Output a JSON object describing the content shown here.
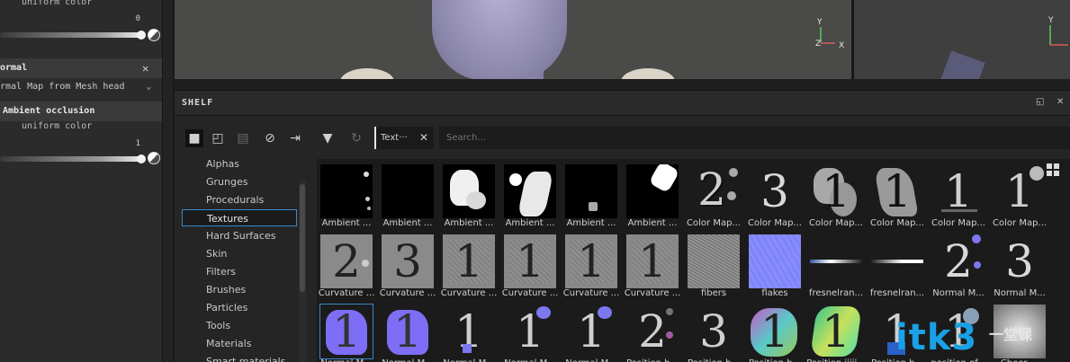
{
  "left_panel": {
    "uniform_color_1": "uniform color",
    "value_1": "0",
    "normal_title": "ormal",
    "normal_source": "rmal Map from Mesh head",
    "ao_title": "Ambient occlusion",
    "uniform_color_2": "uniform color",
    "value_2": "1"
  },
  "viewport": {
    "axis_y": "Y",
    "axis_z": "Z",
    "axis_x": "X",
    "axis_y2": "Y"
  },
  "shelf": {
    "title": "SHELF",
    "filter_tab_label": "Text···",
    "search_placeholder": "Search...",
    "categories": [
      "Alphas",
      "Grunges",
      "Procedurals",
      "Textures",
      "Hard Surfaces",
      "Skin",
      "Filters",
      "Brushes",
      "Particles",
      "Tools",
      "Materials",
      "Smart materials"
    ],
    "selected_category": "Textures",
    "rows": [
      [
        "Ambient ...",
        "Ambient ...",
        "Ambient ...",
        "Ambient ...",
        "Ambient ...",
        "Ambient ...",
        "Color Map...",
        "Color Map...",
        "Color Map...",
        "Color Map...",
        "Color Map...",
        "Color Map..."
      ],
      [
        "Curvature ...",
        "Curvature ...",
        "Curvature ...",
        "Curvature ...",
        "Curvature ...",
        "Curvature ...",
        "fibers",
        "flakes",
        "fresnelran...",
        "fresnelran...",
        "Normal M...",
        "Normal M..."
      ],
      [
        "Normal M...",
        "Normal M...",
        "Normal M...",
        "Normal M...",
        "Normal M...",
        "Position b...",
        "Position b...",
        "Position b...",
        "Position ijiii...",
        "Position b...",
        "position of...",
        "Cheer ..."
      ]
    ]
  },
  "watermark": {
    "text": "itk3",
    "sub": "一堂课"
  },
  "colors": {
    "accent": "#3b88c8",
    "normal_blue": "#8a7dff",
    "panel": "#2b2b2b"
  }
}
